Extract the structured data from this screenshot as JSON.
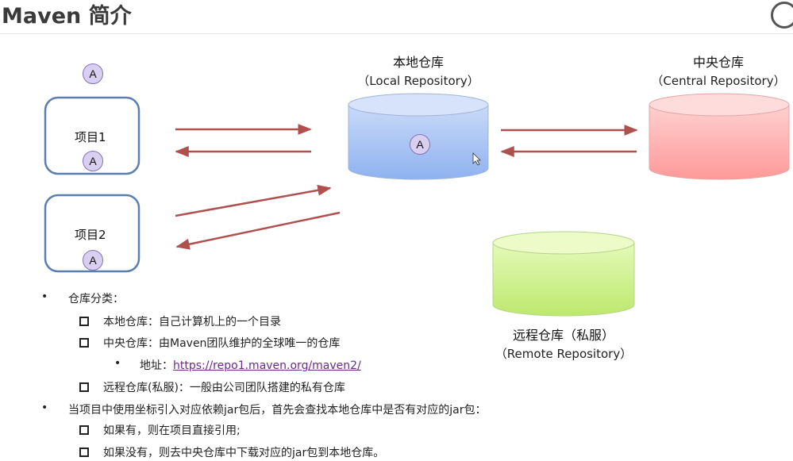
{
  "title": "Maven 简介",
  "diagram": {
    "project1": "项目1",
    "project2": "项目2",
    "artifact": "A",
    "local": {
      "name": "本地仓库",
      "en": "（Local Repository）"
    },
    "central": {
      "name": "中央仓库",
      "en": "（Central Repository）"
    },
    "remote": {
      "name": "远程仓库（私服）",
      "en": "（Remote Repository）"
    },
    "colors": {
      "project_border": "#5a7fae",
      "arrow": "#b0504e",
      "local": "#a9c4f5",
      "central": "#ffb0b0",
      "remote": "#ccf08a",
      "badge": "#d9cff0"
    }
  },
  "notes": {
    "b1": "仓库分类：",
    "b1_items": [
      "本地仓库：自己计算机上的一个目录",
      "中央仓库：由Maven团队维护的全球唯一的仓库",
      "远程仓库(私服)：一般由公司团队搭建的私有仓库"
    ],
    "address_label": "地址：",
    "address_url": "https://repo1.maven.org/maven2/",
    "b2": "当项目中使用坐标引入对应依赖jar包后，首先会查找本地仓库中是否有对应的jar包：",
    "b2_items": [
      "如果有，则在项目直接引用;",
      "如果没有，则去中央仓库中下载对应的jar包到本地仓库。"
    ]
  }
}
